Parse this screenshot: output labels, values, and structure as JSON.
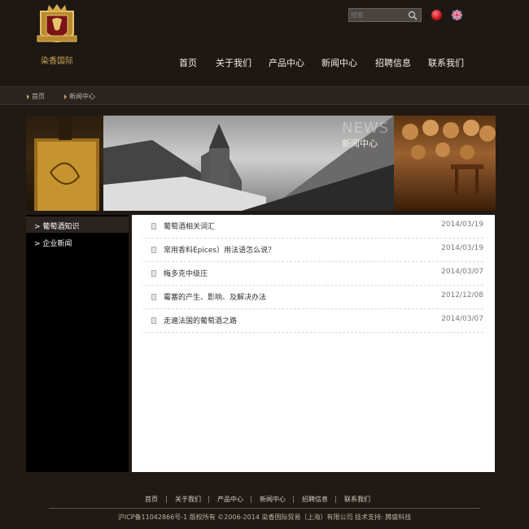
{
  "header": {
    "logo_text": "染香国际",
    "search": {
      "placeholder": "搜索"
    },
    "languages": [
      {
        "name": "中文",
        "icon": "flag-cn-icon"
      },
      {
        "name": "English",
        "icon": "flag-uk-icon"
      }
    ],
    "nav": [
      "首页",
      "关于我们",
      "产品中心",
      "新闻中心",
      "招聘信息",
      "联系我们"
    ]
  },
  "breadcrumb": [
    "首页",
    "新闻中心"
  ],
  "banner": {
    "news_label": "NEWS",
    "title": "新闻中心"
  },
  "sidebar": {
    "items": [
      {
        "label": "葡萄酒知识",
        "active": true
      },
      {
        "label": "企业新闻",
        "active": false
      }
    ]
  },
  "news": [
    {
      "title": "葡萄酒相关词汇",
      "date": "2014/03/19"
    },
    {
      "title": "常用香料Épices）用法语怎么说？",
      "date": "2014/03/19"
    },
    {
      "title": "梅多克中级庄",
      "date": "2014/03/07"
    },
    {
      "title": "霉塞的产生、影响、及解决办法",
      "date": "2012/12/08"
    },
    {
      "title": "走遍法国的葡萄酒之路",
      "date": "2014/03/07"
    }
  ],
  "footer": {
    "nav": [
      "首页",
      "关于我们",
      "产品中心",
      "新闻中心",
      "招聘信息",
      "联系我们"
    ],
    "copyright": "沪ICP备11042866号-1 版权所有 ©2006-2014 染香国际贸易（上海）有限公司 技术支持: 腾盛科技"
  },
  "colors": {
    "background": "#201914",
    "accent_gold": "#c9a45a",
    "content_bg": "#ffffff"
  }
}
